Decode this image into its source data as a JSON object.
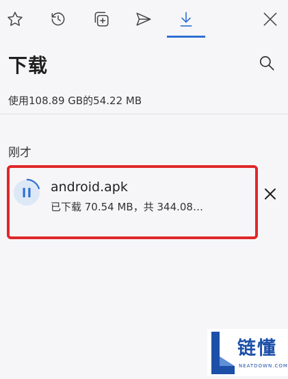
{
  "toolbar": {
    "icons": [
      "star-icon",
      "history-icon",
      "add-collection-icon",
      "send-icon",
      "download-icon",
      "close-icon"
    ],
    "active": "download-icon",
    "accent": "#2f6fd0"
  },
  "header": {
    "title": "下载",
    "search_icon": "search-icon"
  },
  "storage": {
    "text": "使用108.89 GB的54.22 MB"
  },
  "section": {
    "label": "刚才"
  },
  "download": {
    "filename": "android.apk",
    "status": "已下载 70.54 MB，共 344.08…",
    "progress": 0.205,
    "highlight_color": "#e0262a"
  },
  "watermark": {
    "text": "链懂",
    "sub": "NEATDOWN.COM"
  }
}
